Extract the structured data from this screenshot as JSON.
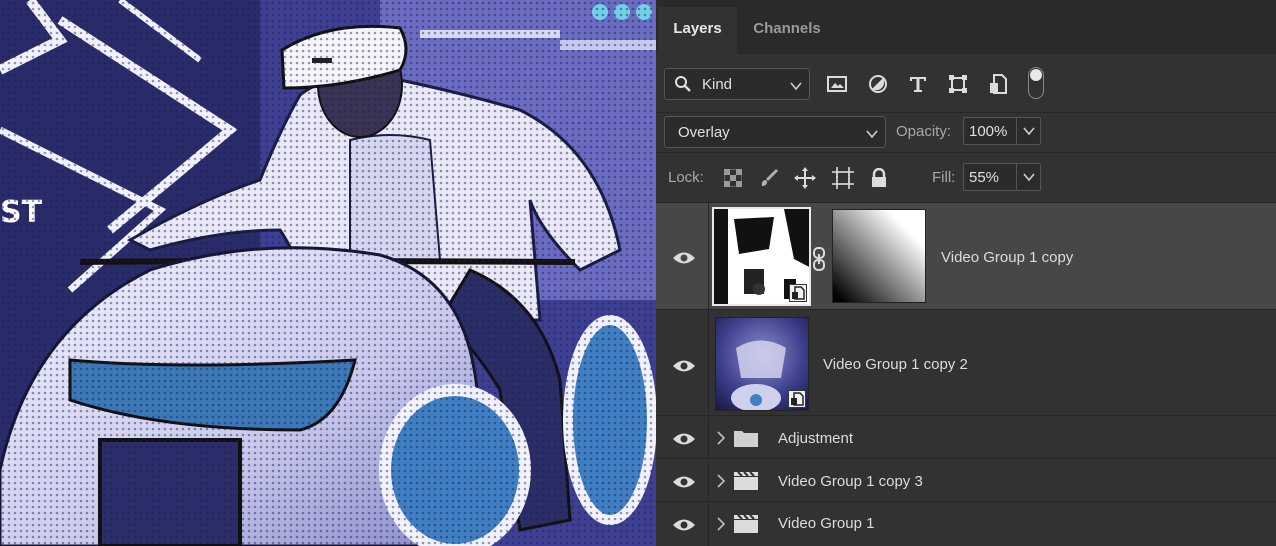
{
  "tabs": [
    {
      "label": "Layers",
      "active": true
    },
    {
      "label": "Channels",
      "active": false
    }
  ],
  "filter": {
    "kind_label": "Kind",
    "icons": [
      "image-filter-icon",
      "adjustment-filter-icon",
      "type-filter-icon",
      "shape-filter-icon",
      "smart-object-filter-icon"
    ],
    "toggle": "filter-toggle"
  },
  "blend": {
    "mode": "Overlay",
    "opacity_label": "Opacity:",
    "opacity_value": "100%"
  },
  "lock": {
    "label": "Lock:",
    "icons": [
      "lock-transparent-icon",
      "lock-image-icon",
      "lock-position-icon",
      "lock-artboard-icon",
      "lock-all-icon"
    ],
    "fill_label": "Fill:",
    "fill_value": "55%"
  },
  "layers": [
    {
      "name": "Video Group 1 copy",
      "type": "smart-object-with-mask",
      "visible": true,
      "selected": true
    },
    {
      "name": "Video Group 1 copy 2",
      "type": "smart-object",
      "visible": true,
      "selected": false
    },
    {
      "name": "Adjustment",
      "type": "folder",
      "visible": true,
      "selected": false
    },
    {
      "name": "Video Group 1 copy 3",
      "type": "video-group",
      "visible": true,
      "selected": false
    },
    {
      "name": "Video Group 1",
      "type": "video-group",
      "visible": true,
      "selected": false
    }
  ],
  "canvas": {
    "sign_text": "ST"
  },
  "colors": {
    "panel_bg": "#323232",
    "selected_row": "#474747",
    "tabbar_bg": "#2a2a2a",
    "text": "#dcdcdc"
  }
}
